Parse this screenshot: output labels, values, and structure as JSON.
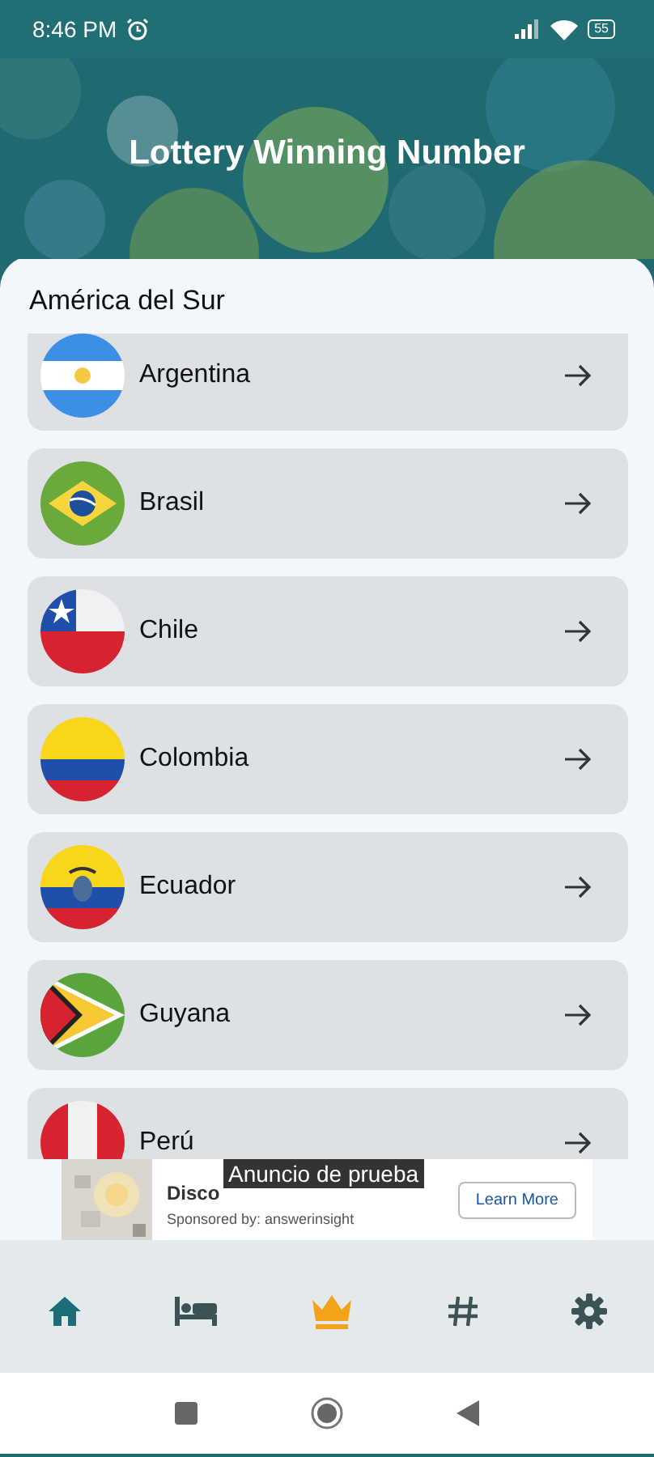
{
  "status_bar": {
    "time": "8:46 PM",
    "battery": "55"
  },
  "header": {
    "title": "Lottery Winning Number"
  },
  "section": {
    "title": "América del Sur"
  },
  "countries": [
    {
      "name": "Argentina",
      "kind": "argentina"
    },
    {
      "name": "Brasil",
      "kind": "brazil"
    },
    {
      "name": "Chile",
      "kind": "chile"
    },
    {
      "name": "Colombia",
      "kind": "colombia"
    },
    {
      "name": "Ecuador",
      "kind": "ecuador"
    },
    {
      "name": "Guyana",
      "kind": "guyana"
    },
    {
      "name": "Perú",
      "kind": "peru"
    }
  ],
  "ad": {
    "label": "Anuncio de prueba",
    "headline": "Disco",
    "sponsor": "Sponsored by: answerinsight",
    "button": "Learn More"
  },
  "bottom_nav": [
    {
      "kind": "home",
      "selected": false
    },
    {
      "kind": "bed",
      "selected": false
    },
    {
      "kind": "crown",
      "selected": true
    },
    {
      "kind": "hash",
      "selected": false
    },
    {
      "kind": "settings",
      "selected": false
    }
  ]
}
